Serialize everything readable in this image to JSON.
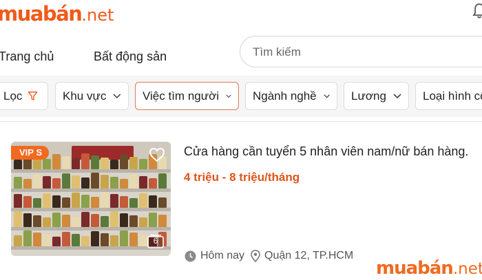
{
  "brand": {
    "name": "muabán",
    "tld": ".net",
    "color": "#f05a1a"
  },
  "nav": {
    "home": "Trang chủ",
    "real_estate": "Bất động sản"
  },
  "search": {
    "placeholder": "Tìm kiếm",
    "value": ""
  },
  "filters": {
    "filter_label": "Lọc",
    "chips": [
      {
        "label": "Khu vực",
        "active": false
      },
      {
        "label": "Việc tìm người",
        "active": true
      },
      {
        "label": "Ngành nghề",
        "active": false
      },
      {
        "label": "Lương",
        "active": false
      },
      {
        "label": "Loại hình cô",
        "active": false
      }
    ]
  },
  "listing": {
    "badge": "VIP S",
    "title": "Cửa hàng cần tuyển 5 nhân viên nam/nữ bán hàng.",
    "salary": "4 triệu - 8 triệu/tháng",
    "posted": "Hôm nay",
    "location": "Quận 12, TP.HCM",
    "image_count": "6",
    "image_icon": "photo-gallery-icon"
  },
  "watermark": {
    "name": "muabán",
    "tld": ".net"
  },
  "colors": {
    "accent": "#f05a1a",
    "salary": "#e0541a",
    "active_border": "#d97a52",
    "badge_bg": "#f06a1f"
  }
}
